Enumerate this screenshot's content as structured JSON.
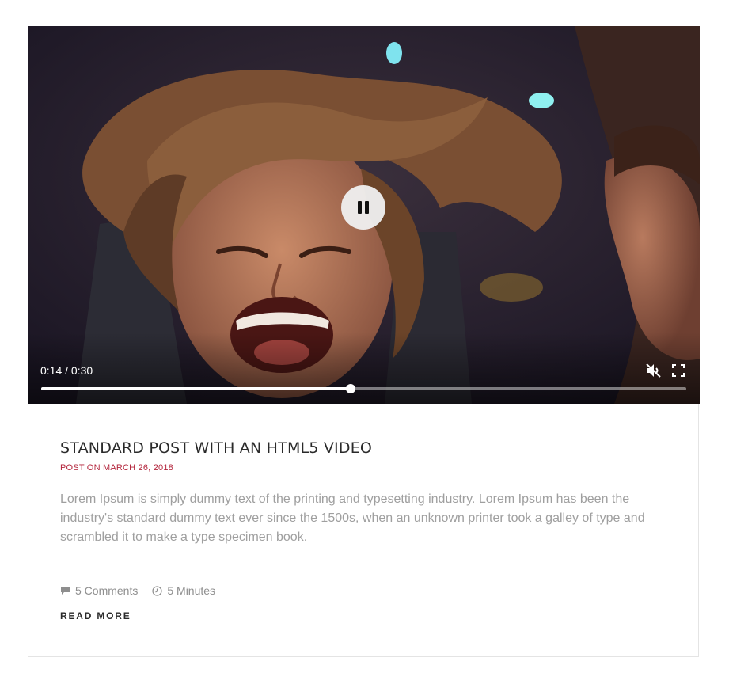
{
  "post": {
    "title": "STANDARD POST WITH AN HTML5 VIDEO",
    "meta": "POST ON MARCH 26, 2018",
    "excerpt": "Lorem Ipsum is simply dummy text of the printing and typesetting industry. Lorem Ipsum has been the industry's standard dummy text ever since the 1500s, when an unknown printer took a galley of type and scrambled it to make a type specimen book.",
    "comments": "5 Comments",
    "read_time": "5 Minutes",
    "read_more": "READ MORE"
  },
  "video": {
    "time_display": "0:14 / 0:30",
    "progress_fraction": 0.48,
    "state": "playing",
    "muted": true,
    "icons": [
      "pause-icon",
      "mute-icon",
      "fullscreen-icon"
    ]
  },
  "colors": {
    "accent": "#b3243b",
    "title": "#2a2a2a",
    "body_text": "#9f9f9f",
    "meta_text": "#8e8e8e"
  }
}
